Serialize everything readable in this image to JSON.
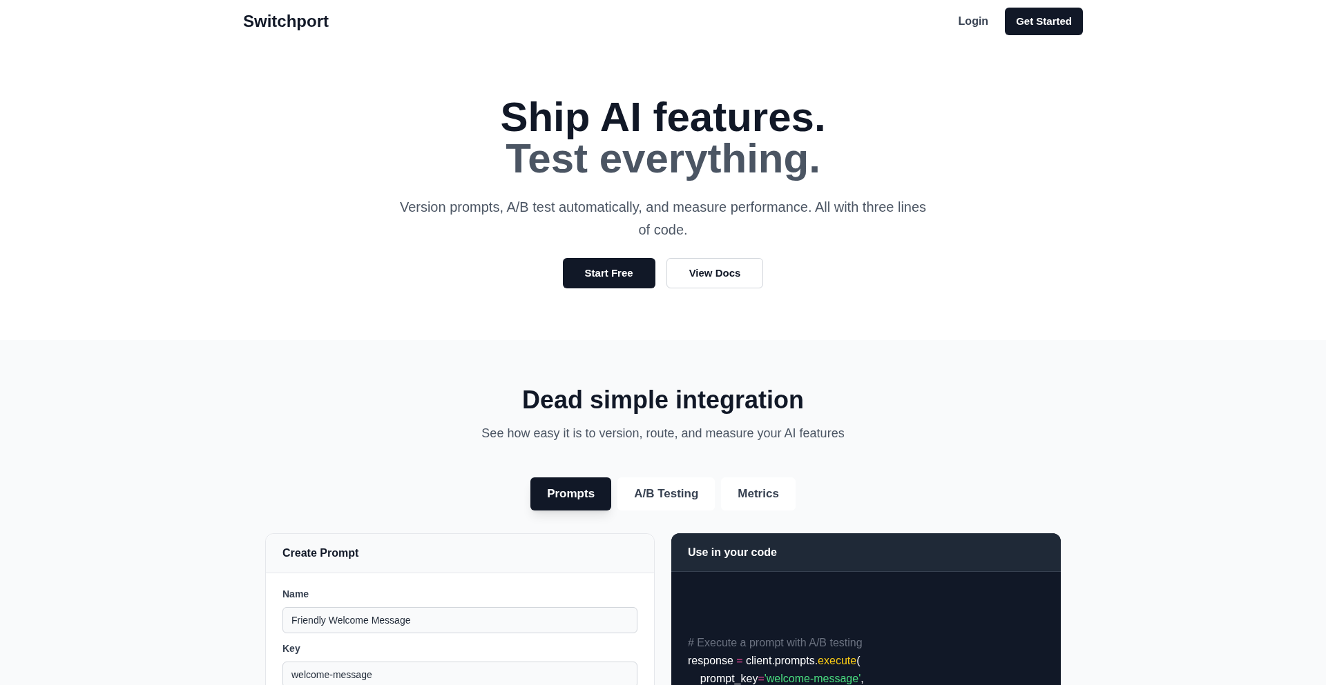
{
  "nav": {
    "logo": "Switchport",
    "login": "Login",
    "cta": "Get Started"
  },
  "hero": {
    "title_line_1": "Ship AI features.",
    "title_line_2": "Test everything.",
    "subtitle": "Version prompts, A/B test automatically, and measure performance. All with three lines of code.",
    "buttons": [
      {
        "label": "Start Free",
        "kind": "primary"
      },
      {
        "label": "View Docs",
        "kind": "secondary"
      }
    ]
  },
  "integration": {
    "title": "Dead simple integration",
    "subtitle": "See how easy it is to version, route, and measure your AI features",
    "tabs": [
      {
        "label": "Prompts",
        "selected": true
      },
      {
        "label": "A/B Testing",
        "selected": false
      },
      {
        "label": "Metrics",
        "selected": false
      }
    ],
    "form_card": {
      "title": "Create Prompt",
      "fields": [
        {
          "label": "Name",
          "value": "Friendly Welcome Message"
        },
        {
          "label": "Key",
          "value": "welcome-message"
        }
      ]
    },
    "code_card": {
      "title": "Use in your code",
      "lines": [
        [
          {
            "kind": "comment",
            "text": "# Execute a prompt with A/B testing"
          }
        ],
        [
          {
            "kind": "plain",
            "text": "response "
          },
          {
            "kind": "operator",
            "text": "="
          },
          {
            "kind": "plain",
            "text": " client.prompts."
          },
          {
            "kind": "function",
            "text": "execute"
          },
          {
            "kind": "plain",
            "text": "("
          }
        ],
        [
          {
            "kind": "plain",
            "text": "    prompt_key"
          },
          {
            "kind": "operator",
            "text": "="
          },
          {
            "kind": "string",
            "text": "'welcome-message'"
          },
          {
            "kind": "plain",
            "text": ","
          }
        ]
      ]
    }
  }
}
